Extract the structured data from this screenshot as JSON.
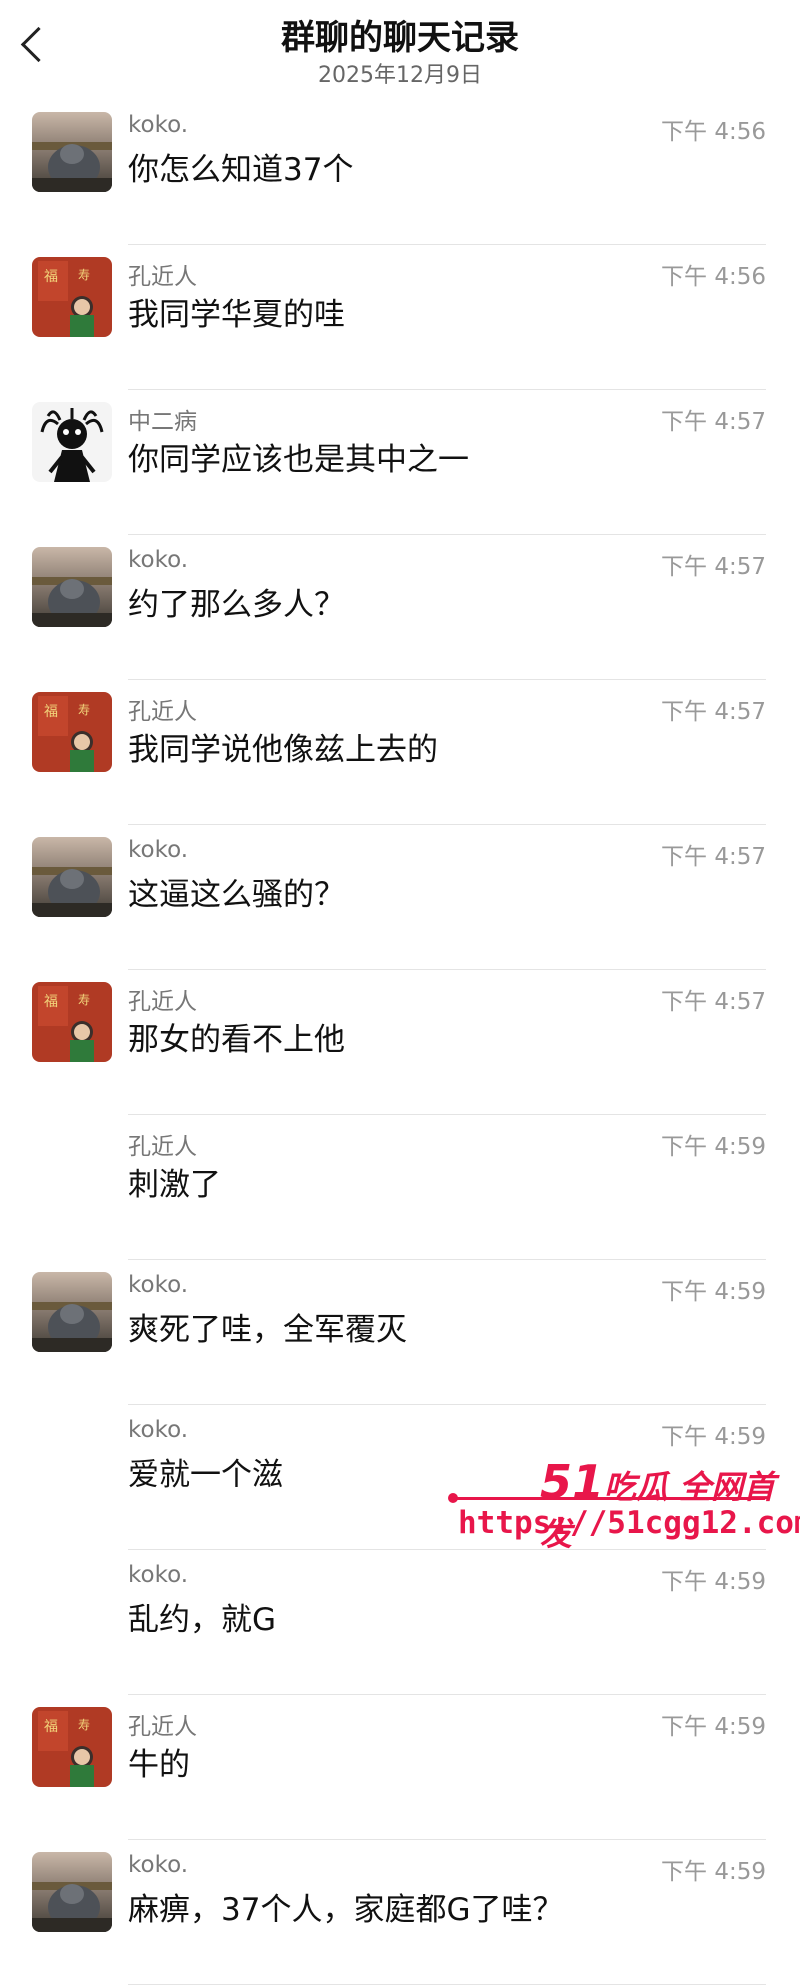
{
  "header": {
    "title": "群聊的聊天记录",
    "date": "2025年12月9日"
  },
  "messages": [
    {
      "name": "koko.",
      "time": "下午 4:56",
      "text": "你怎么知道37个",
      "avatar": "koko-avatar"
    },
    {
      "name": "孔近人",
      "time": "下午 4:56",
      "text": "我同学华夏的哇",
      "avatar": "kong-avatar"
    },
    {
      "name": "中二病",
      "time": "下午 4:57",
      "text": "你同学应该也是其中之一",
      "avatar": "zhong-avatar"
    },
    {
      "name": "koko.",
      "time": "下午 4:57",
      "text": "约了那么多人？",
      "avatar": "koko-avatar"
    },
    {
      "name": "孔近人",
      "time": "下午 4:57",
      "text": "我同学说他像兹上去的",
      "avatar": "kong-avatar"
    },
    {
      "name": "koko.",
      "time": "下午 4:57",
      "text": "这逼这么骚的？",
      "avatar": "koko-avatar"
    },
    {
      "name": "孔近人",
      "time": "下午 4:57",
      "text": "那女的看不上他",
      "avatar": "kong-avatar"
    },
    {
      "name": "孔近人",
      "time": "下午 4:59",
      "text": "刺激了",
      "avatar": ""
    },
    {
      "name": "koko.",
      "time": "下午 4:59",
      "text": "爽死了哇，全军覆灭",
      "avatar": "koko-avatar"
    },
    {
      "name": "koko.",
      "time": "下午 4:59",
      "text": "爱就一个滋",
      "avatar": ""
    },
    {
      "name": "koko.",
      "time": "下午 4:59",
      "text": "乱约，就G",
      "avatar": ""
    },
    {
      "name": "孔近人",
      "time": "下午 4:59",
      "text": "牛的",
      "avatar": "kong-avatar"
    },
    {
      "name": "koko.",
      "time": "下午 4:59",
      "text": "麻痹，37个人，家庭都G了哇？",
      "avatar": "koko-avatar"
    }
  ],
  "watermark": {
    "brand_num": "51",
    "brand_text": "吃瓜 全网首发",
    "url": "https://51cgg12.com"
  },
  "colors": {
    "watermark": "#e8164a",
    "divider": "#e4e4e4",
    "meta_text": "#999999"
  }
}
